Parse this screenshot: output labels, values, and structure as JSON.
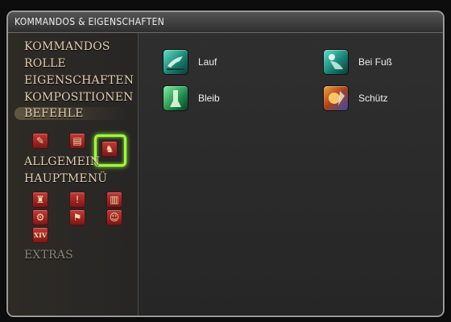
{
  "window": {
    "title": "KOMMANDOS & EIGENSCHAFTEN"
  },
  "sidebar": {
    "categories": [
      {
        "label": "KOMMANDOS"
      },
      {
        "label": "ROLLE"
      },
      {
        "label": "EIGENSCHAFTEN"
      },
      {
        "label": "KOMPOSITIONEN"
      },
      {
        "label": "BEFEHLE",
        "selected": true
      },
      {
        "label": "ALLGEMEIN"
      },
      {
        "label": "HAUPTMENÜ"
      },
      {
        "label": "EXTRAS"
      }
    ],
    "befehle_icons": [
      "book-quill-icon",
      "scroll-icon",
      "chocobo-order-icon"
    ],
    "hauptmenu_icons": [
      "character-icon",
      "alert-icon",
      "journal-icon",
      "gear-tool-icon",
      "flag-icon",
      "people-icon",
      "xiv-logo-icon"
    ],
    "xiv_text": "XIV"
  },
  "actions": [
    {
      "label": "Lauf",
      "icon": "chocobo-run-icon",
      "color": "teal"
    },
    {
      "label": "Bei Fuß",
      "icon": "chocobo-follow-icon",
      "color": "teal"
    },
    {
      "label": "Bleib",
      "icon": "chocobo-stay-icon",
      "color": "green"
    },
    {
      "label": "Schütz",
      "icon": "chocobo-defend-icon",
      "color": "fire"
    }
  ],
  "colors": {
    "accent_highlight": "#9dff38",
    "category_text": "#e2cfae",
    "icon_red": "#b0302c"
  }
}
